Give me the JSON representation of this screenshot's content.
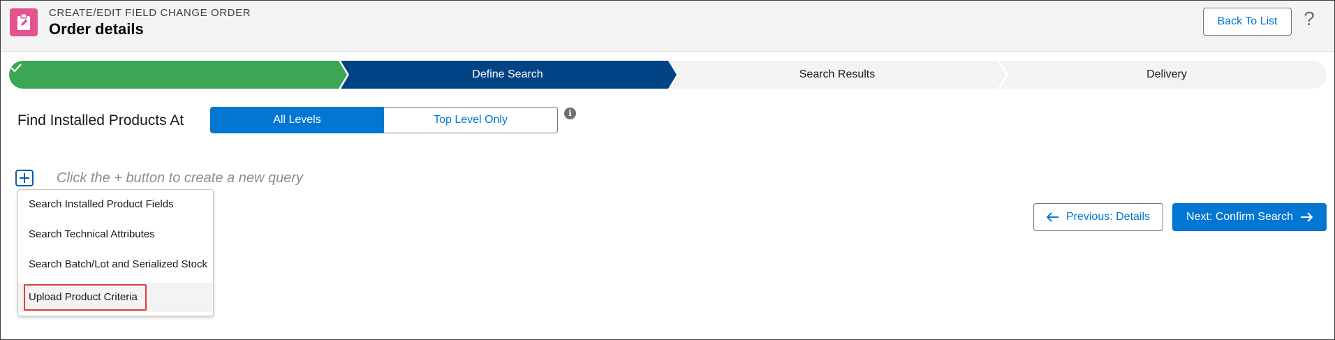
{
  "header": {
    "eyebrow": "CREATE/EDIT FIELD CHANGE ORDER",
    "title": "Order details",
    "back_label": "Back To List",
    "help_glyph": "?",
    "icon": "clipboard-edit-icon"
  },
  "path": {
    "steps": [
      {
        "label": "",
        "state": "complete",
        "icon": "check-icon"
      },
      {
        "label": "Define Search",
        "state": "current"
      },
      {
        "label": "Search Results",
        "state": "incomplete"
      },
      {
        "label": "Delivery",
        "state": "incomplete"
      }
    ]
  },
  "search_level": {
    "label": "Find Installed Products At",
    "options": [
      "All Levels",
      "Top Level Only"
    ],
    "selected": "All Levels",
    "info_glyph": "i"
  },
  "query": {
    "hint": "Click the + button to create a new query",
    "menu_items": [
      "Search Installed Product Fields",
      "Search Technical Attributes",
      "Search Batch/Lot and Serialized Stock",
      "Upload Product Criteria"
    ]
  },
  "nav": {
    "previous_label": "Previous: Details",
    "next_label": "Next: Confirm Search"
  },
  "colors": {
    "complete": "#3ba755",
    "current": "#014486",
    "incomplete": "#f3f3f3",
    "brand": "#0176d3",
    "app_icon": "#e3548f",
    "highlight": "#e03c3c"
  }
}
